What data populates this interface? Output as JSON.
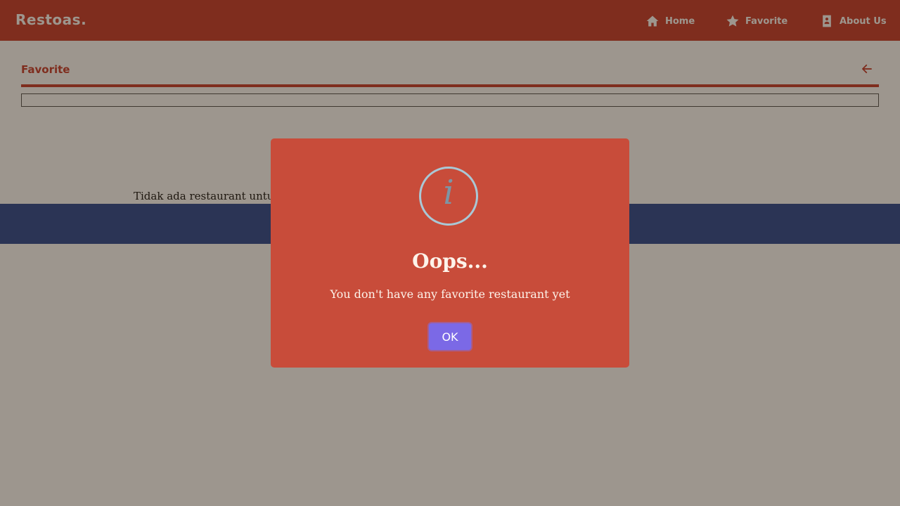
{
  "header": {
    "brand": "Restoas.",
    "nav": [
      {
        "label": "Home",
        "icon": "home-icon"
      },
      {
        "label": "Favorite",
        "icon": "star-icon"
      },
      {
        "label": "About Us",
        "icon": "contact-card-icon"
      }
    ]
  },
  "main": {
    "section_title": "Favorite",
    "back_icon": "arrow-left-icon",
    "search_value": "",
    "empty_message": "Tidak ada restaurant untuk ditampilkan"
  },
  "dialog": {
    "icon": "info-icon",
    "icon_glyph": "i",
    "title": "Oops...",
    "message": "You don't have any favorite restaurant yet",
    "ok_label": "OK"
  },
  "colors": {
    "primary": "#c22d1f",
    "footer": "#1b3a8c",
    "dialog_bg": "#c84c3a",
    "ok_button": "#7b69e6"
  }
}
